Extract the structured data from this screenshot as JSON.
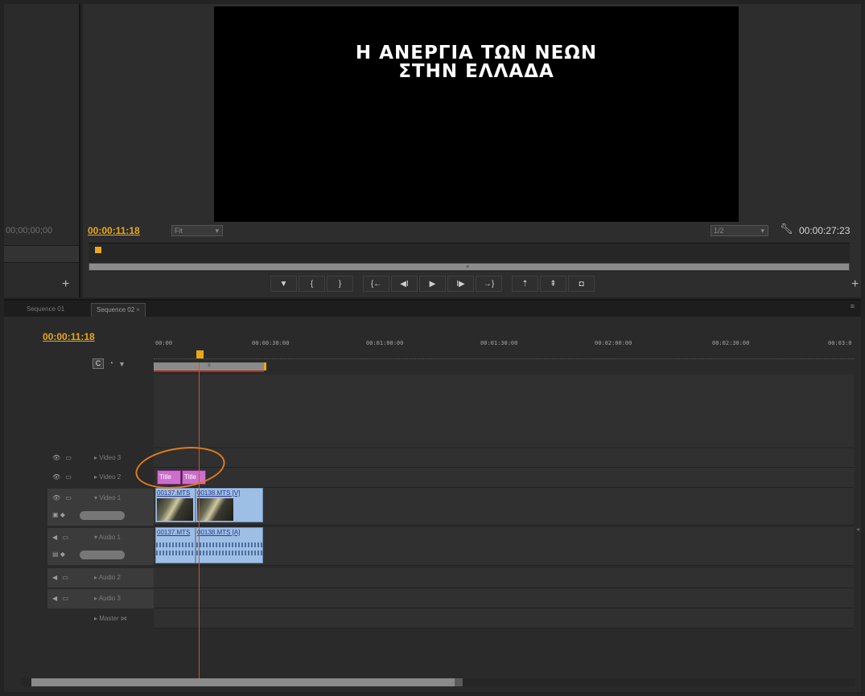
{
  "source_monitor": {
    "timecode": "00;00;00;00",
    "add_label": "+"
  },
  "program_monitor": {
    "video_title_line1": "Η ΑΝΕΡΓΙΑ ΤΩΝ ΝΕΩΝ",
    "video_title_line2": "ΣΤΗΝ ΕΛΛΑΔΑ",
    "current_timecode": "00:00:11:18",
    "zoom_select": "Fit",
    "resolution_select": "1/2",
    "duration_timecode": "00:00:27:23",
    "add_label": "+",
    "transport": [
      {
        "name": "add-marker-button",
        "glyph": "▼"
      },
      {
        "name": "mark-in-button",
        "glyph": "{"
      },
      {
        "name": "mark-out-button",
        "glyph": "}"
      },
      {
        "name": "go-to-in-button",
        "glyph": "{←"
      },
      {
        "name": "step-back-button",
        "glyph": "◀I"
      },
      {
        "name": "play-button",
        "glyph": "▶"
      },
      {
        "name": "step-forward-button",
        "glyph": "I▶"
      },
      {
        "name": "go-to-out-button",
        "glyph": "→}"
      },
      {
        "name": "lift-button",
        "glyph": "⇡"
      },
      {
        "name": "extract-button",
        "glyph": "⇞"
      },
      {
        "name": "export-frame-button",
        "glyph": "◘"
      }
    ]
  },
  "timeline": {
    "tabs": [
      "Sequence 01",
      "Sequence 02"
    ],
    "tab_close": "×",
    "panel_menu": "≡",
    "current_timecode": "00:00:11:18",
    "ruler_labels": [
      "00:00",
      "00:00:30:00",
      "00:01:00:00",
      "00:01:30:00",
      "00:02:00:00",
      "00:02:30:00",
      "00:03:0"
    ],
    "tracks": [
      {
        "name": "Video 3",
        "kind": "video"
      },
      {
        "name": "Video 2",
        "kind": "video"
      },
      {
        "name": "Video 1",
        "kind": "video"
      },
      {
        "name": "Audio 1",
        "kind": "audio"
      },
      {
        "name": "Audio 2",
        "kind": "audio"
      },
      {
        "name": "Audio 3",
        "kind": "audio"
      },
      {
        "name": "Master",
        "kind": "master"
      }
    ],
    "clips": {
      "title_1": "Title",
      "title_2": "Title",
      "video_1": "00137.MTS",
      "video_2": "00138.MTS [V]",
      "audio_1": "00137.MTS",
      "audio_2": "00138.MTS [A]"
    }
  },
  "colors": {
    "timecode": "#e8a818",
    "playhead": "#d4532a",
    "annotation_circle": "#e07a20",
    "title_clip": "#cc6fcc",
    "media_clip": "#9ebfe5"
  }
}
